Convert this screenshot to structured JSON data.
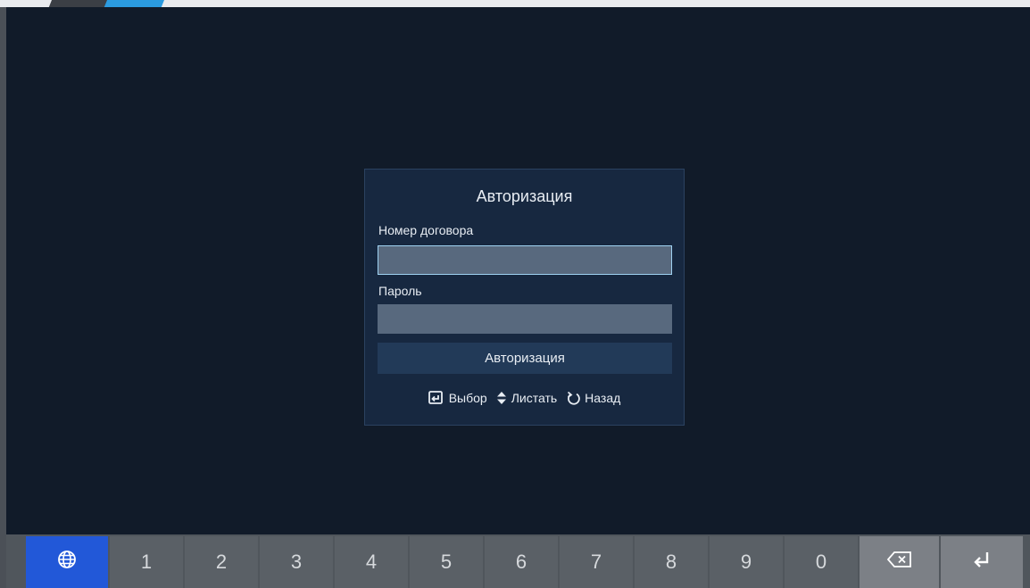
{
  "dialog": {
    "title": "Авторизация",
    "contract_label": "Номер договора",
    "contract_value": "",
    "password_label": "Пароль",
    "password_value": "",
    "submit_label": "Авторизация"
  },
  "hints": [
    {
      "icon": "enter-icon",
      "label": "Выбор"
    },
    {
      "icon": "up-down-icon",
      "label": "Листать"
    },
    {
      "icon": "back-icon",
      "label": "Назад"
    }
  ],
  "keyboard": {
    "lang_icon": "globe-icon",
    "digits": [
      "1",
      "2",
      "3",
      "4",
      "5",
      "6",
      "7",
      "8",
      "9",
      "0"
    ],
    "backspace_icon": "backspace-icon",
    "enter_icon": "return-icon"
  },
  "colors": {
    "screen_bg": "#111b29",
    "dialog_bg": "#172840",
    "field_bg": "#58697e",
    "focus_border": "#9fd2f2",
    "button_bg": "#223a58",
    "key_bg": "#5a6066",
    "lang_key_bg": "#2258d8",
    "action_key_bg": "#7c8086"
  }
}
